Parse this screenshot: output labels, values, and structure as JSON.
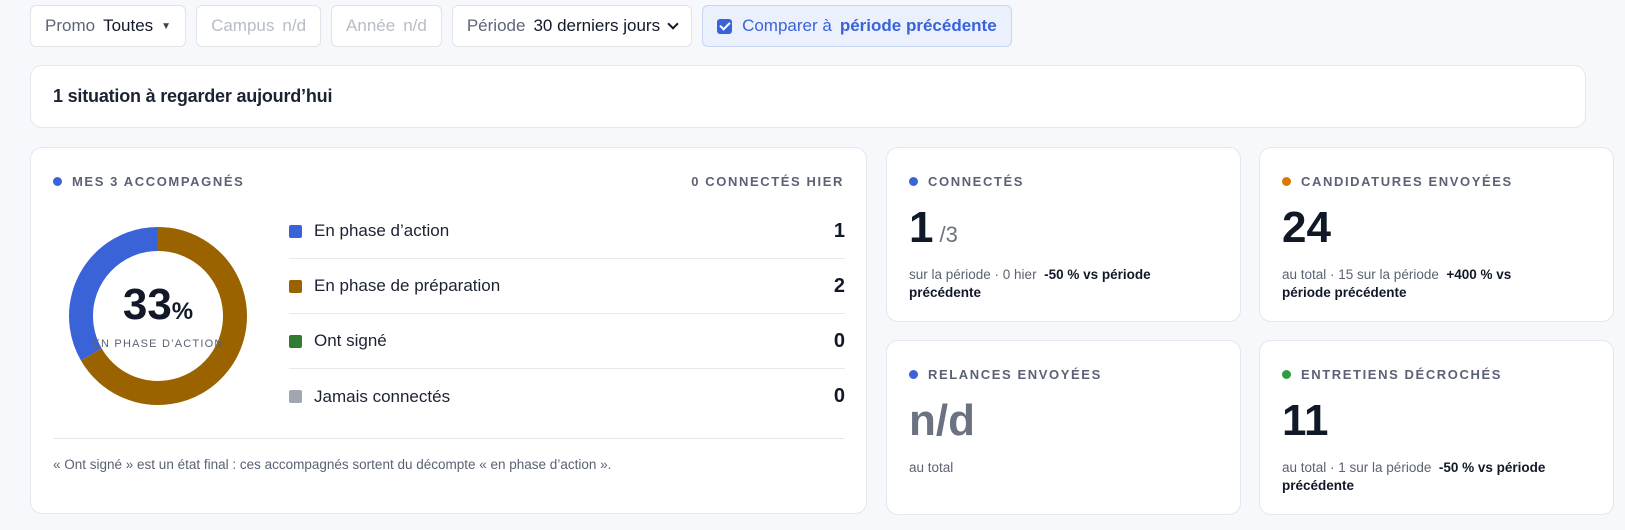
{
  "filters": {
    "promo": {
      "label": "Promo",
      "value": "Toutes"
    },
    "campus": {
      "label": "Campus",
      "value": "n/d"
    },
    "annee": {
      "label": "Année",
      "value": "n/d"
    },
    "periode": {
      "label": "Période",
      "value": "30 derniers jours"
    },
    "compare": {
      "label": "Comparer à",
      "value": "période précédente",
      "checked": true
    }
  },
  "situation": {
    "text": "1 situation à regarder aujourd’hui"
  },
  "accompagnes": {
    "title": "MES 3 ACCOMPAGNÉS",
    "right": "0 CONNECTÉS HIER",
    "dot_color": "#3b63d8",
    "donut": {
      "percent": "33",
      "percent_sign": "%",
      "label": "EN PHASE D’ACTION",
      "segments": [
        {
          "name": "action",
          "value": 1,
          "color": "#3b63d8"
        },
        {
          "name": "preparation",
          "value": 2,
          "color": "#9a6300"
        }
      ]
    },
    "legend": [
      {
        "label": "En phase d’action",
        "value": "1",
        "color": "#3b63d8"
      },
      {
        "label": "En phase de préparation",
        "value": "2",
        "color": "#9a6300"
      },
      {
        "label": "Ont signé",
        "value": "0",
        "color": "#2e7d32"
      },
      {
        "label": "Jamais connectés",
        "value": "0",
        "color": "#a0a6b2"
      }
    ],
    "footnote": "« Ont signé » est un état final : ces accompagnés sortent du décompte « en phase d’action »."
  },
  "connectes": {
    "title": "CONNECTÉS",
    "dot_color": "#3b63d8",
    "value": "1",
    "sub": "/3",
    "meta": "sur la période · 0 hier",
    "delta": "-50 % vs période précédente"
  },
  "candidatures": {
    "title": "CANDIDATURES ENVOYÉES",
    "dot_color": "#d97a00",
    "value": "24",
    "meta": "au total · 15 sur la période",
    "delta": "+400 % vs période précédente"
  },
  "relances": {
    "title": "RELANCES ENVOYÉES",
    "dot_color": "#3b63d8",
    "value": "n/d",
    "meta": "au total"
  },
  "entretiens": {
    "title": "ENTRETIENS DÉCROCHÉS",
    "dot_color": "#2e9d45",
    "value": "11",
    "meta": "au total · 1 sur la période",
    "delta": "-50 % vs période précédente"
  }
}
